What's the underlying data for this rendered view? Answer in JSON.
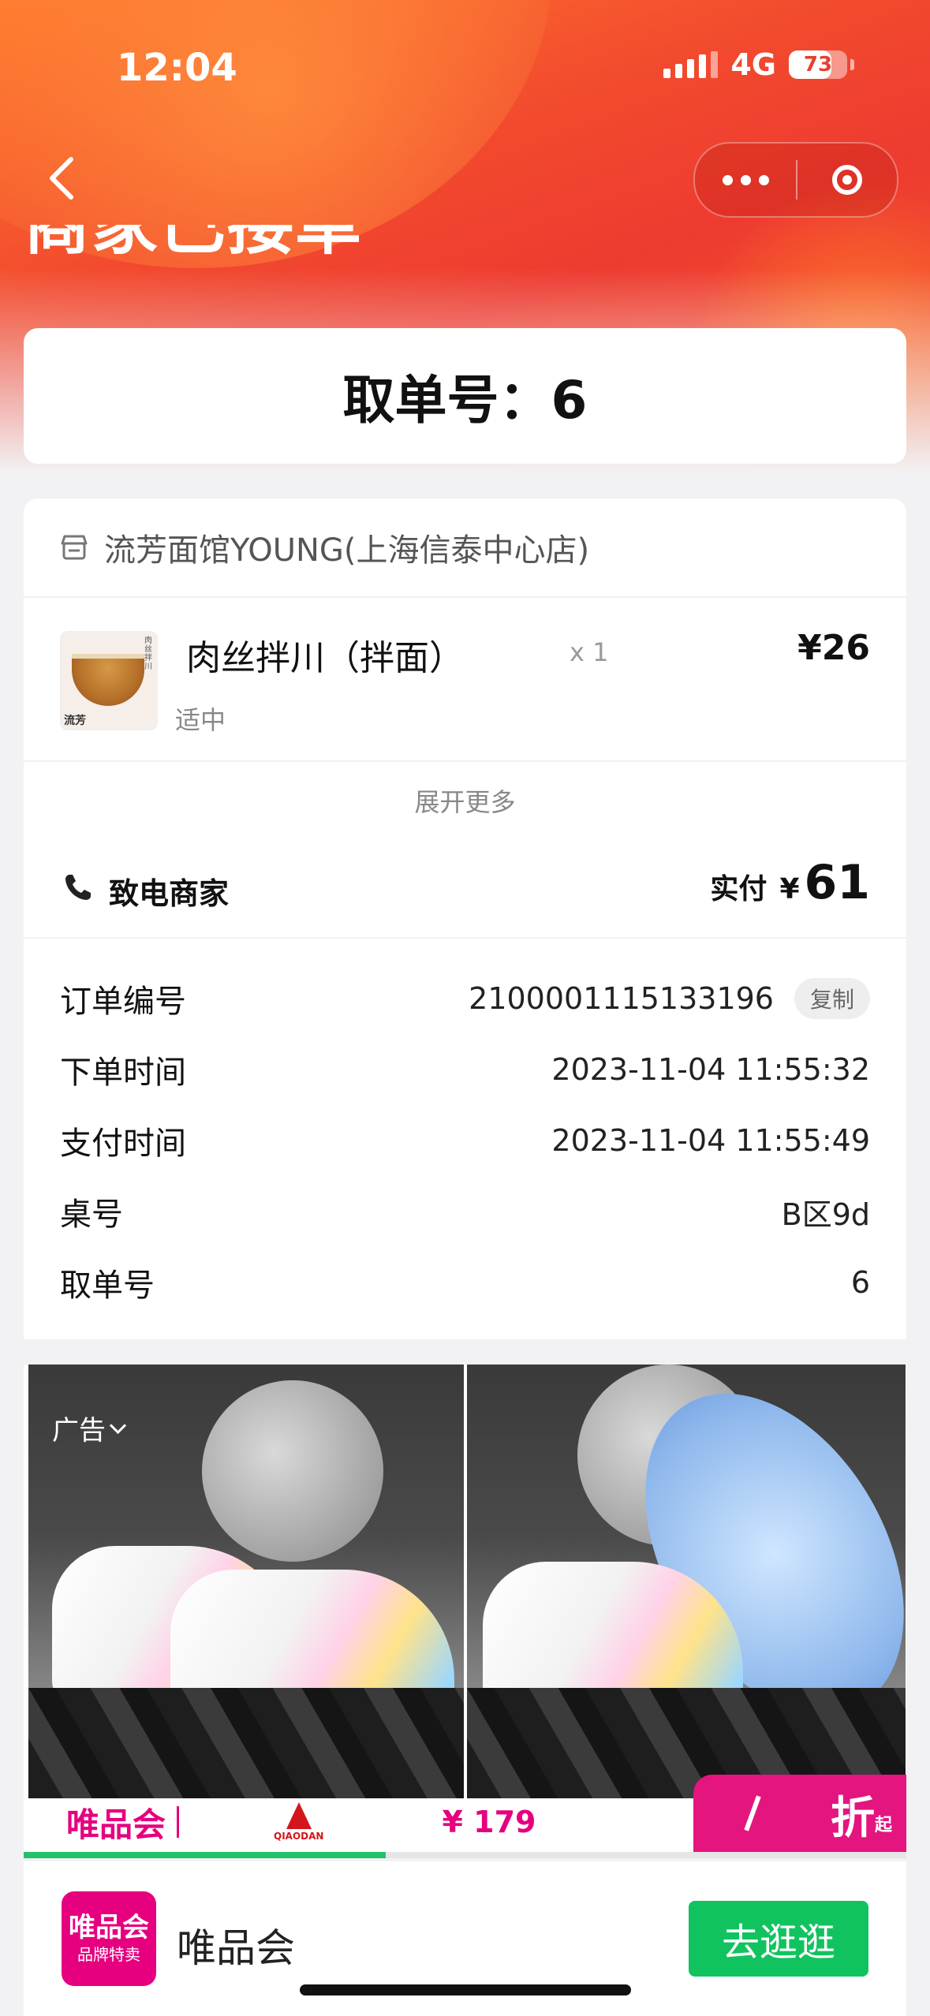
{
  "status": {
    "time": "12:04",
    "network": "4G",
    "battery": "73"
  },
  "nav": {
    "title": "商家已接单"
  },
  "pickup": {
    "text": "取单号：6"
  },
  "order": {
    "store_name": "流芳面馆YOUNG(上海信泰中心店)",
    "item": {
      "name": "肉丝拌川（拌面）",
      "qty": "x 1",
      "price": "¥26",
      "spec": "适中",
      "thumb_tag": "流芳",
      "thumb_side": "肉丝拌川"
    },
    "expand_label": "展开更多",
    "call_label": "致电商家",
    "paid_label": "实付",
    "currency": "¥",
    "paid_amount": "61"
  },
  "info": {
    "rows": [
      {
        "key": "订单编号",
        "value": "2100001115133196",
        "action": "复制"
      },
      {
        "key": "下单时间",
        "value": "2023-11-04 11:55:32"
      },
      {
        "key": "支付时间",
        "value": "2023-11-04 11:55:49"
      },
      {
        "key": "桌号",
        "value": "B区9d"
      },
      {
        "key": "取单号",
        "value": "6"
      }
    ]
  },
  "ad": {
    "label": "广告",
    "brand": "唯品会",
    "partner": "QIAODAN",
    "price": "¥  179",
    "discount": "折",
    "discount_suffix": "起",
    "progress": 0.41
  },
  "vip": {
    "logo_top": "唯品会",
    "logo_bottom": "品牌特卖",
    "name": "唯品会",
    "button": "去逛逛"
  },
  "colors": {
    "accent_red": "#ee3b30",
    "vip_pink": "#e6007f",
    "green": "#11c35f"
  }
}
